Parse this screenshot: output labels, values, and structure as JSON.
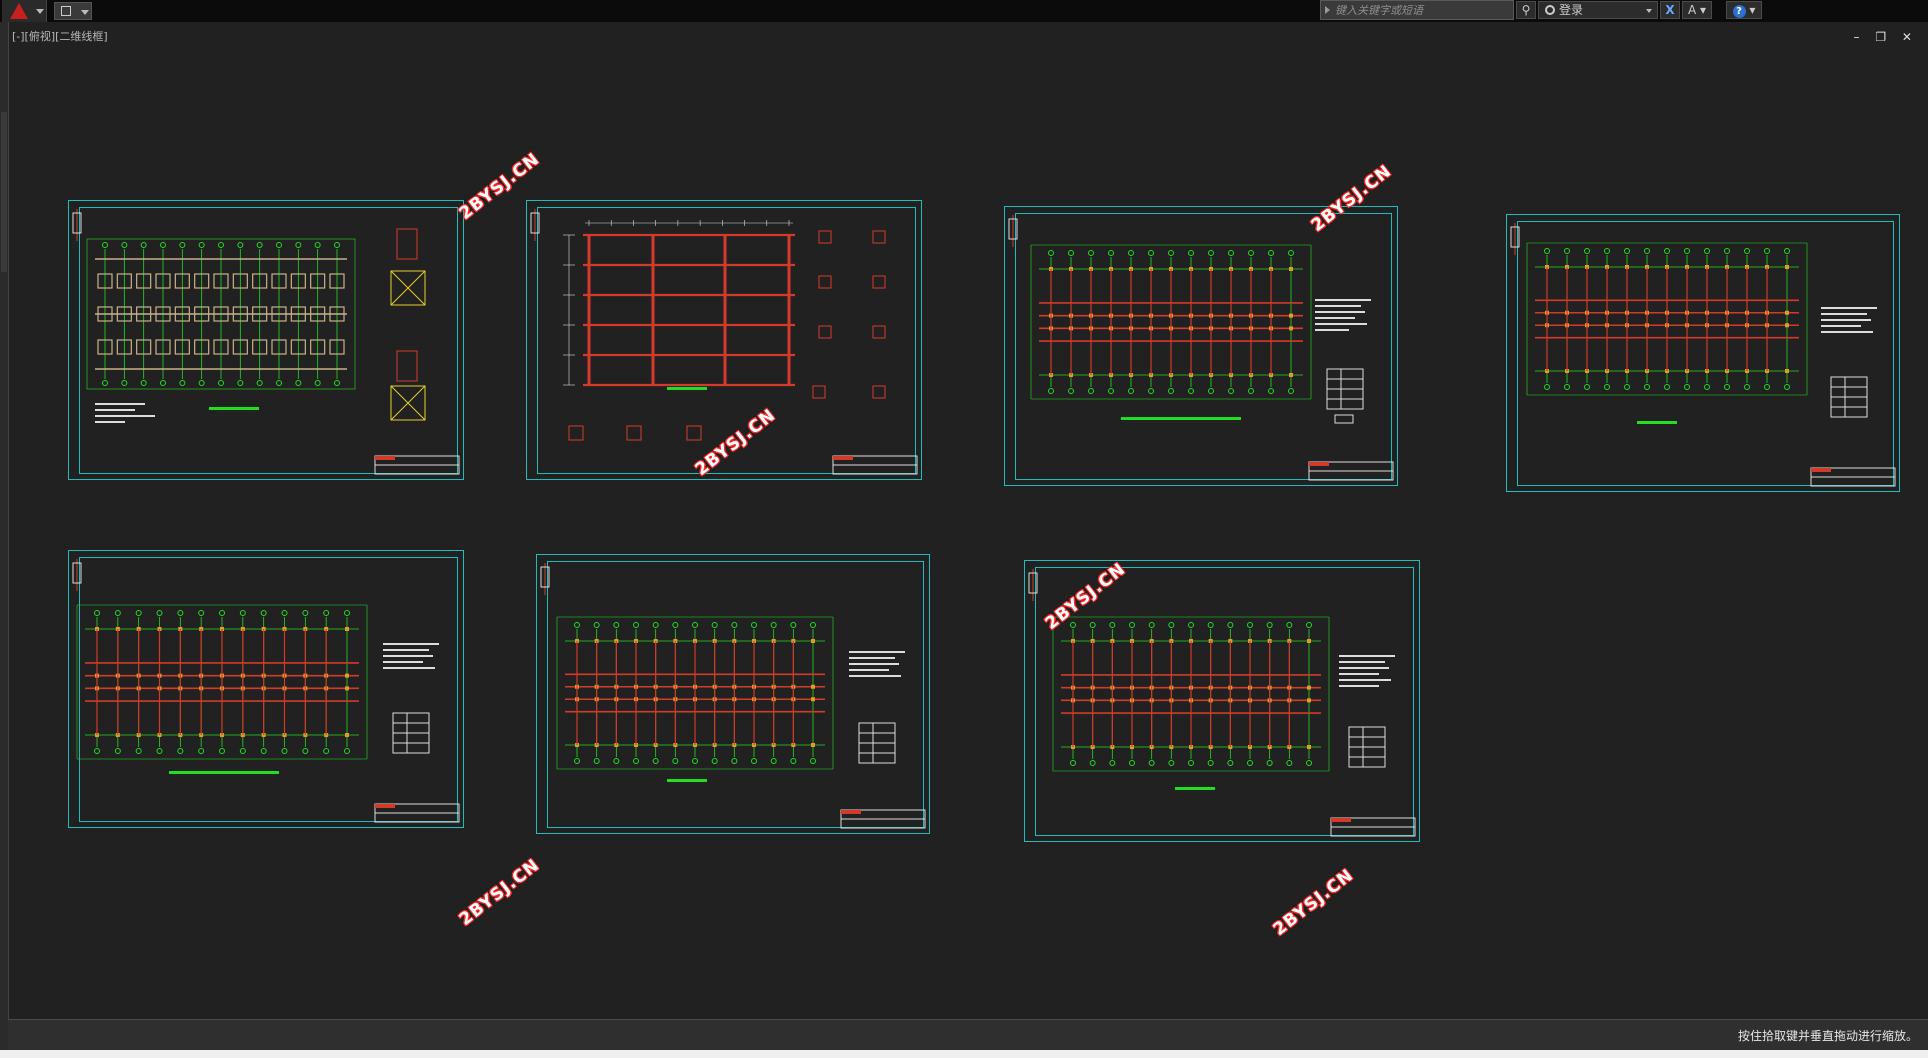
{
  "toolbar": {
    "search_placeholder": "键入关键字或短语",
    "login_label": "登录",
    "x_label": "X",
    "a_label": "A",
    "help_label": "?"
  },
  "document": {
    "viewport_label": "[-][俯视][二维线框]",
    "window_controls": "– ❐ ✕"
  },
  "status": {
    "message": "按住拾取键并垂直拖动进行缩放。"
  },
  "watermark": "2BYSJ.CN",
  "colors": {
    "background": "#212121",
    "sheet_border": "#1fbcbc",
    "grid_green": "#22dd22",
    "beam_red": "#d23a2a",
    "column_orange": "#e39a2a",
    "watermark_outline": "#ff2a2a"
  },
  "sheets": [
    {
      "id": "sheet-1",
      "type": "foundation-plan"
    },
    {
      "id": "sheet-2",
      "type": "frame-elevation"
    },
    {
      "id": "sheet-3",
      "type": "floor-plan"
    },
    {
      "id": "sheet-4",
      "type": "floor-plan"
    },
    {
      "id": "sheet-5",
      "type": "floor-plan"
    },
    {
      "id": "sheet-6",
      "type": "floor-plan"
    },
    {
      "id": "sheet-7",
      "type": "floor-plan"
    }
  ]
}
